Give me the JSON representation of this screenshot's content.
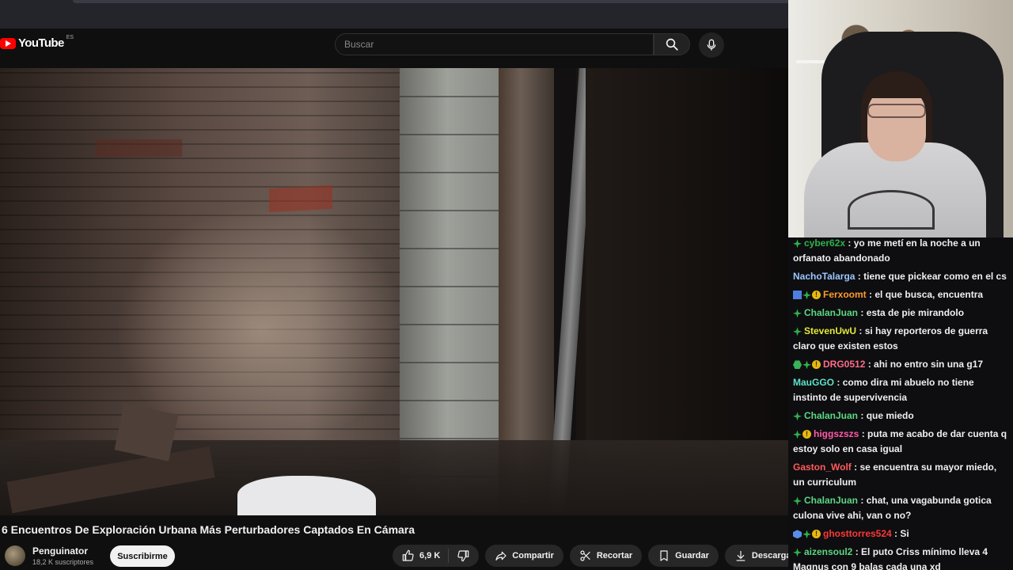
{
  "youtube": {
    "logo_text": "YouTube",
    "country_code": "ES",
    "search_placeholder": "Buscar"
  },
  "video": {
    "title": "6 Encuentros De Exploración Urbana Más Perturbadores Captados En Cámara",
    "channel_name": "Penguinator",
    "subscribers": "18,2 K suscriptores",
    "subscribe_label": "Suscribirme",
    "like_count": "6,9 K",
    "share_label": "Compartir",
    "clip_label": "Recortar",
    "save_label": "Guardar",
    "download_label": "Descargar"
  },
  "chat": {
    "messages": [
      {
        "user": "cyber62x",
        "color": "#2fb24c",
        "text": "yo me metí en la noche a un orfanato abandonado",
        "badges": [
          "gem"
        ]
      },
      {
        "user": "NachoTalarga",
        "color": "#9cc6ff",
        "text": "tiene que pickear como en el cs",
        "badges": []
      },
      {
        "user": "Ferxoomt",
        "color": "#ff9a2e",
        "text": "el que busca, encuentra",
        "badges": [
          "sq",
          "gem",
          "coin"
        ]
      },
      {
        "user": "ChalanJuan",
        "color": "#5cd683",
        "text": "esta de pie mirandolo",
        "badges": [
          "gem"
        ]
      },
      {
        "user": "StevenUwU",
        "color": "#e3e83a",
        "text": "si hay reporteros de guerra claro que existen estos",
        "badges": [
          "gem"
        ]
      },
      {
        "user": "DRG0512",
        "color": "#ff6b8a",
        "text": "ahi no entro sin una g17",
        "badges": [
          "hex",
          "gem",
          "coin"
        ]
      },
      {
        "user": "MauGGO",
        "color": "#5ee0c8",
        "text": "como dira mi abuelo no tiene instinto de supervivencia",
        "badges": []
      },
      {
        "user": "ChalanJuan",
        "color": "#5cd683",
        "text": "que miedo",
        "badges": [
          "gem"
        ]
      },
      {
        "user": "higgszszs",
        "color": "#ff5aa8",
        "text": "puta me acabo de dar cuenta q estoy solo en casa igual",
        "badges": [
          "gem",
          "coin"
        ]
      },
      {
        "user": "Gaston_Wolf",
        "color": "#ff5a5a",
        "text": "se encuentra su mayor miedo, un curriculum",
        "badges": []
      },
      {
        "user": "ChalanJuan",
        "color": "#5cd683",
        "text": "chat, una vagabunda gotica culona vive ahi, van o no?",
        "badges": [
          "gem"
        ]
      },
      {
        "user": "ghosttorres524",
        "color": "#ff3838",
        "text": "Si",
        "badges": [
          "cube",
          "gem",
          "coin"
        ]
      },
      {
        "user": "aizensoul2",
        "color": "#5cd683",
        "text": "El puto Criss mínimo lleva 4 Magnus con 9 balas cada una xd",
        "badges": [
          "gem"
        ]
      }
    ]
  }
}
